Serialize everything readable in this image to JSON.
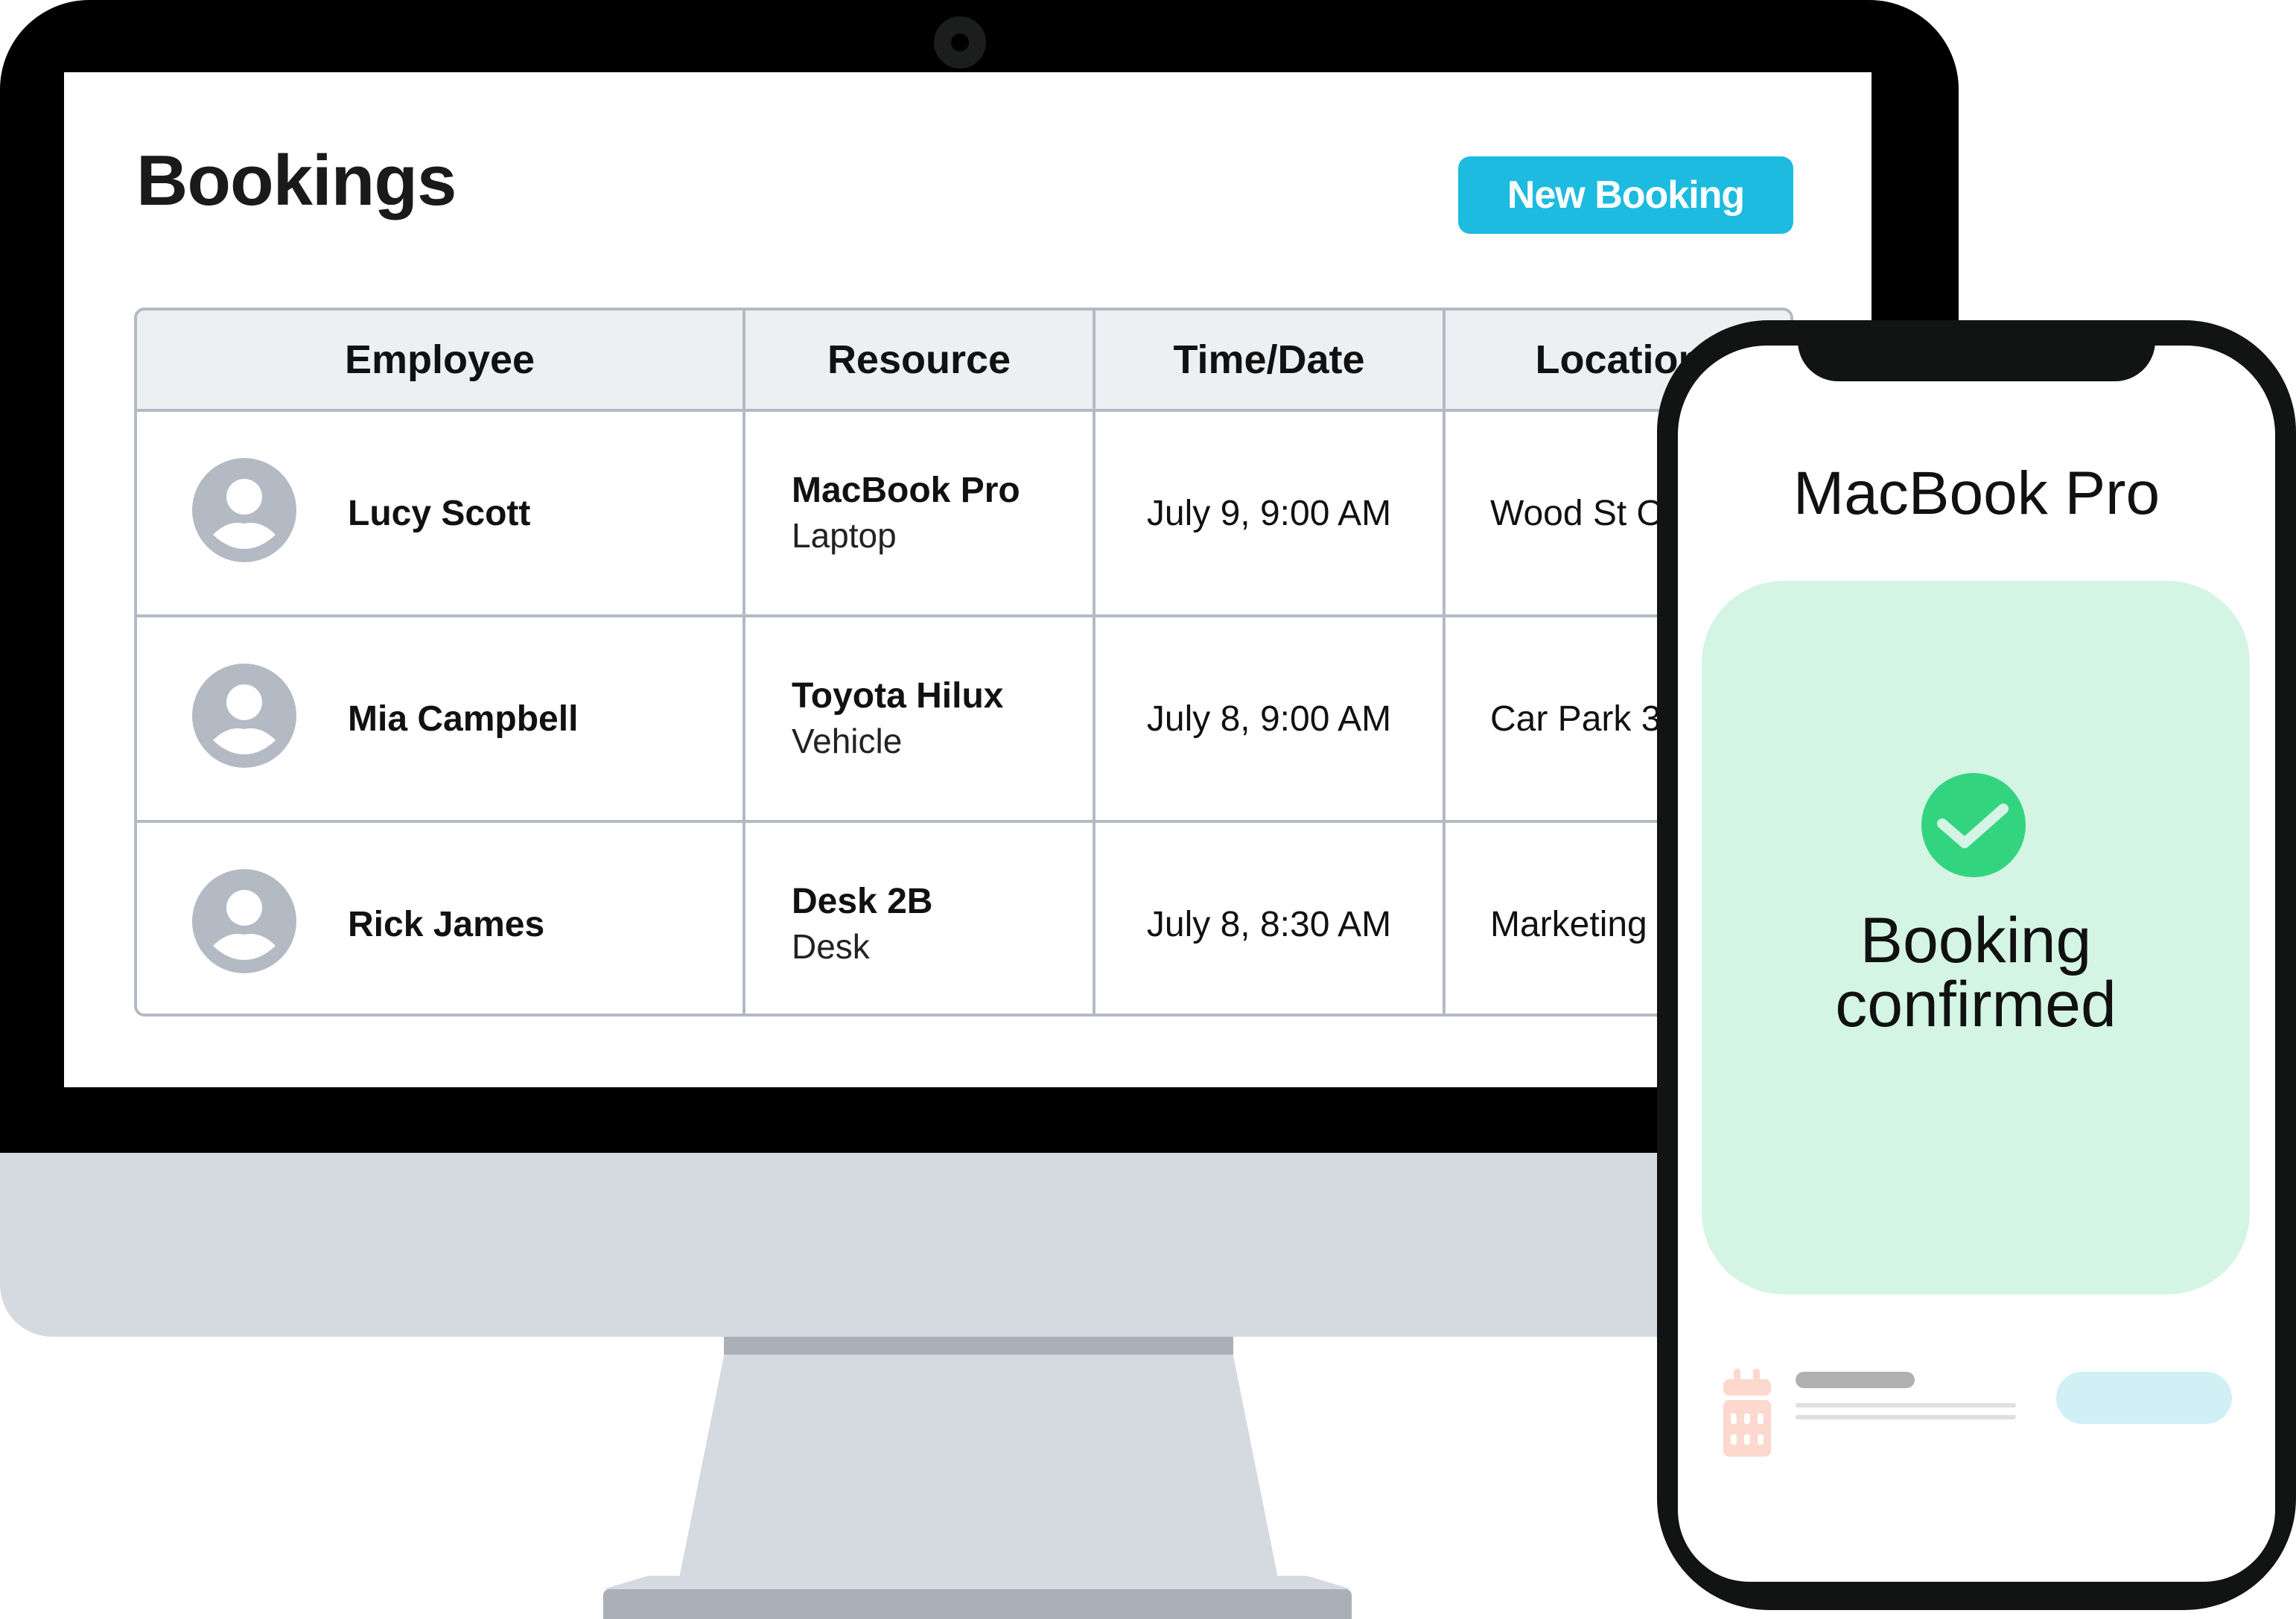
{
  "desktop": {
    "page_title": "Bookings",
    "new_booking_label": "New Booking",
    "accent_color": "#1dbbe0",
    "table": {
      "headers": [
        "Employee",
        "Resource",
        "Time/Date",
        "Location"
      ],
      "rows": [
        {
          "employee": "Lucy Scott",
          "resource_name": "MacBook Pro",
          "resource_type": "Laptop",
          "time_date": "July 9, 9:00 AM",
          "location": "Wood St Office"
        },
        {
          "employee": "Mia Campbell",
          "resource_name": "Toyota Hilux",
          "resource_type": "Vehicle",
          "time_date": "July 8, 9:00 AM",
          "location": "Car Park 3"
        },
        {
          "employee": "Rick James",
          "resource_name": "Desk 2B",
          "resource_type": "Desk",
          "time_date": "July 8, 8:30 AM",
          "location": "Marketing"
        }
      ]
    }
  },
  "mobile": {
    "title": "MacBook Pro",
    "status_line_1": "Booking",
    "status_line_2": "confirmed",
    "status_icon": "check-circle-icon",
    "status_color": "#33d47f",
    "card_color": "#d4f5e4",
    "footer_icon": "calendar-icon"
  }
}
